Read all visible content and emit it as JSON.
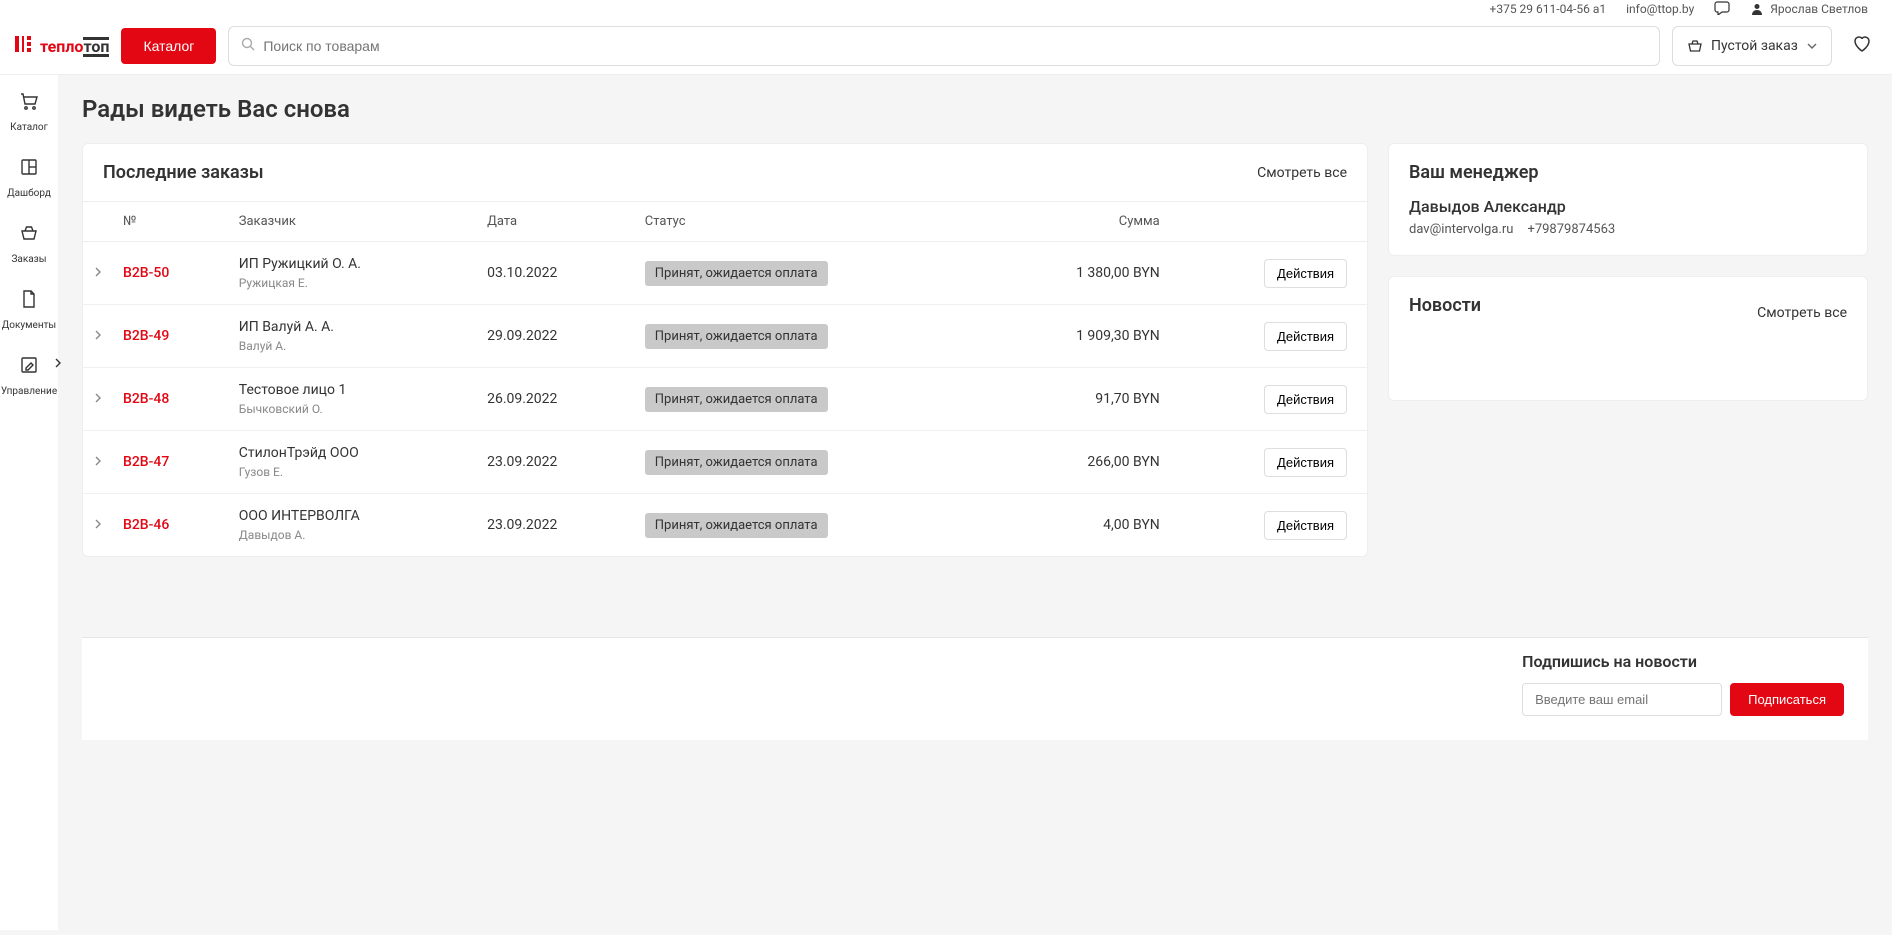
{
  "topbar": {
    "phone": "+375 29 611-04-56 а1",
    "email": "info@ttop.by",
    "user_name": "Ярослав Светлов"
  },
  "header": {
    "logo_brand_1": "тепло",
    "logo_brand_2": "топ",
    "catalog_button": "Каталог",
    "search_placeholder": "Поиск по товарам",
    "cart_label": "Пустой заказ"
  },
  "sidebar": {
    "items": [
      {
        "label": "Каталог"
      },
      {
        "label": "Дашборд"
      },
      {
        "label": "Заказы"
      },
      {
        "label": "Документы"
      },
      {
        "label": "Управление"
      }
    ]
  },
  "page_title": "Рады видеть Вас снова",
  "orders": {
    "title": "Последние заказы",
    "view_all": "Смотреть все",
    "columns": {
      "number": "№",
      "customer": "Заказчик",
      "date": "Дата",
      "status": "Статус",
      "sum": "Сумма"
    },
    "actions_label": "Действия",
    "rows": [
      {
        "num": "B2B-50",
        "customer": "ИП Ружицкий О. А.",
        "contact": "Ружицкая Е.",
        "date": "03.10.2022",
        "status": "Принят, ожидается оплата",
        "sum": "1 380,00 BYN"
      },
      {
        "num": "B2B-49",
        "customer": "ИП Валуй А. А.",
        "contact": "Валуй А.",
        "date": "29.09.2022",
        "status": "Принят, ожидается оплата",
        "sum": "1 909,30 BYN"
      },
      {
        "num": "B2B-48",
        "customer": "Тестовое лицо 1",
        "contact": "Бычковский О.",
        "date": "26.09.2022",
        "status": "Принят, ожидается оплата",
        "sum": "91,70 BYN"
      },
      {
        "num": "B2B-47",
        "customer": "СтилонТрэйд ООО",
        "contact": "Гузов Е.",
        "date": "23.09.2022",
        "status": "Принят, ожидается оплата",
        "sum": "266,00 BYN"
      },
      {
        "num": "B2B-46",
        "customer": "ООО ИНТЕРВОЛГА",
        "contact": "Давыдов А.",
        "date": "23.09.2022",
        "status": "Принят, ожидается оплата",
        "sum": "4,00 BYN"
      }
    ]
  },
  "manager": {
    "title": "Ваш менеджер",
    "name": "Давыдов Александр",
    "email": "dav@intervolga.ru",
    "phone": "+79879874563"
  },
  "news": {
    "title": "Новости",
    "view_all": "Смотреть все"
  },
  "footer": {
    "subscribe_title": "Подпишись на новости",
    "email_placeholder": "Введите ваш email",
    "subscribe_button": "Подписаться"
  }
}
